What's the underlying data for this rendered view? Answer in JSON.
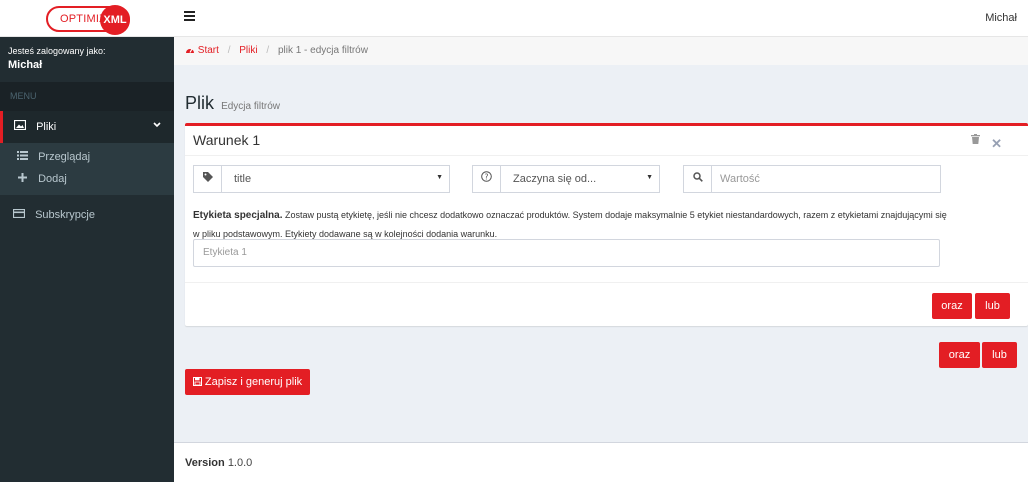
{
  "brand": {
    "logo_text": "OPTIMIZE",
    "logo_badge": "XML"
  },
  "header": {
    "username": "Michał"
  },
  "sidebar": {
    "logged_label": "Jesteś zalogowany jako:",
    "logged_name": "Michał",
    "menu_header": "MENU",
    "items": [
      {
        "label": "Pliki",
        "active": true
      },
      {
        "label": "Subskrypcje"
      }
    ],
    "sub_items": [
      {
        "label": "Przeglądaj"
      },
      {
        "label": "Dodaj"
      }
    ]
  },
  "breadcrumb": {
    "start": "Start",
    "files": "Pliki",
    "current": "plik 1 - edycja filtrów"
  },
  "page": {
    "title": "Plik",
    "subtitle": "Edycja filtrów"
  },
  "condition": {
    "title": "Warunek 1",
    "field_value": "title",
    "operator_value": "Zaczyna się od...",
    "value_placeholder": "Wartość",
    "note_bold": "Etykieta specjalna.",
    "note_text": " Zostaw pustą etykietę, jeśli nie chcesz dodatkowo oznaczać produktów. System dodaje maksymalnie 5 etykiet niestandardowych, razem z etykietami znajdującymi się w pliku podstawowym. Etykiety dodawane są w kolejności dodania warunku.",
    "tag_placeholder": "Etykieta 1",
    "and_label": "oraz",
    "or_label": "lub"
  },
  "actions": {
    "and_label": "oraz",
    "or_label": "lub",
    "save_label": "Zapisz i generuj plik"
  },
  "footer": {
    "version_label": "Version",
    "version_value": "1.0.0"
  },
  "colors": {
    "accent": "#e31e24",
    "sidebar": "#222d32",
    "background": "#ecf0f5"
  }
}
